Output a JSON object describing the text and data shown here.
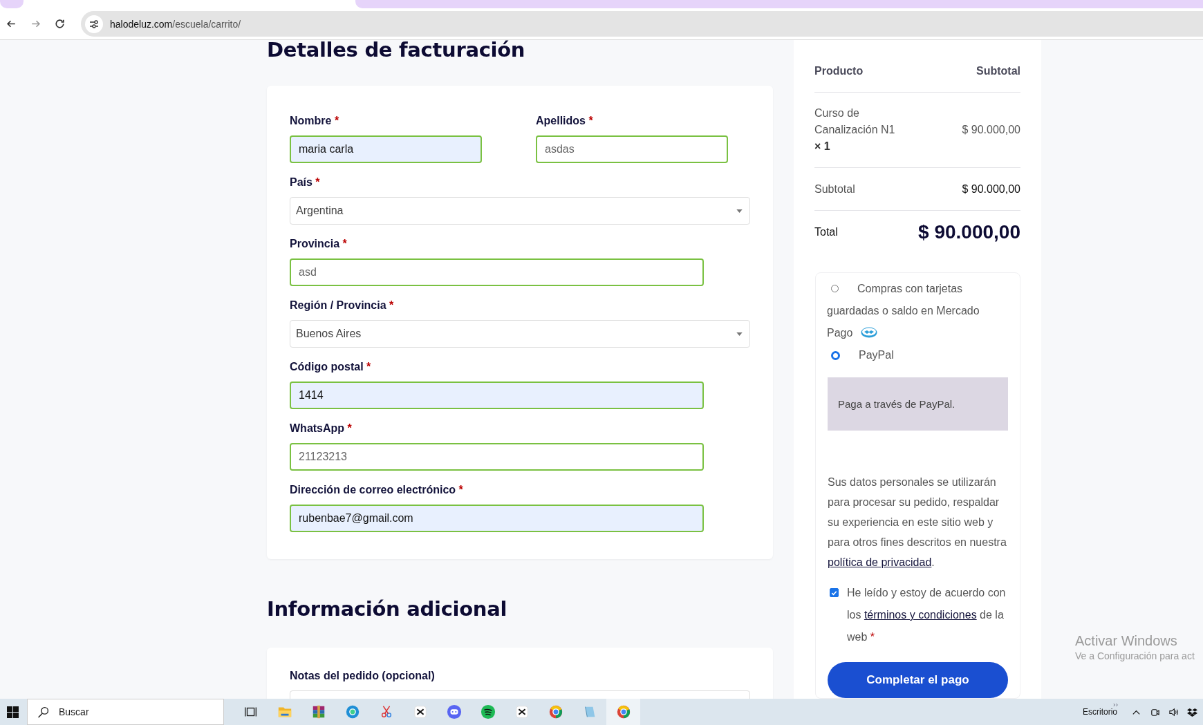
{
  "browser": {
    "url_host": "halodeluz.com",
    "url_path": "/escuela/carrito/"
  },
  "billing": {
    "title": "Detalles de facturación",
    "rows": [
      [
        {
          "label": "Nombre",
          "required": "*",
          "kind": "text",
          "value": "maria carla",
          "autofilled": true,
          "valid": true
        },
        {
          "label": "Apellidos",
          "required": "*",
          "kind": "text",
          "value": "asdas",
          "autofilled": false,
          "valid": true
        }
      ],
      [
        {
          "label": "País",
          "required": "*",
          "kind": "select",
          "value": "Argentina"
        }
      ],
      [
        {
          "label": "Provincia",
          "required": "*",
          "kind": "text",
          "value": "asd",
          "autofilled": false,
          "valid": true
        }
      ],
      [
        {
          "label": "Región / Provincia",
          "required": "*",
          "kind": "select",
          "value": "Buenos Aires"
        }
      ],
      [
        {
          "label": "Código postal",
          "required": "*",
          "kind": "text",
          "value": "1414",
          "autofilled": true,
          "valid": true
        }
      ],
      [
        {
          "label": "WhatsApp",
          "required": "*",
          "kind": "text",
          "value": "21123213",
          "autofilled": false,
          "valid": true
        }
      ],
      [
        {
          "label": "Dirección de correo electrónico",
          "required": "*",
          "kind": "text",
          "value": "rubenbae7@gmail.com",
          "autofilled": true,
          "valid": true
        }
      ]
    ]
  },
  "additional": {
    "title": "Información adicional",
    "notes_label": "Notas del pedido (opcional)"
  },
  "order": {
    "headers": [
      "Producto",
      "Subtotal"
    ],
    "items": [
      {
        "name": "Curso de Canalización N1",
        "quantity": "× 1",
        "price": "$ 90.000,00"
      }
    ],
    "subtotal_label": "Subtotal",
    "subtotal": "$ 90.000,00",
    "total_label": "Total",
    "total": "$ 90.000,00"
  },
  "payment": {
    "methods": [
      {
        "label": "Compras con tarjetas guardadas o saldo en Mercado Pago",
        "selected": false,
        "logo": true
      },
      {
        "label": "PayPal",
        "selected": true,
        "logo": false,
        "description": "Paga a través de PayPal."
      }
    ],
    "privacy_text": "Sus datos personales se utilizarán para procesar su pedido, respaldar su experiencia en este sitio web y para otros fines descritos en nuestra",
    "privacy_link": "política de privacidad",
    "privacy_end": ".",
    "terms": {
      "checked": true,
      "before": "He leído y estoy de acuerdo con los",
      "link": "términos y condiciones",
      "after": "de la web",
      "required": "*"
    },
    "submit": "Completar el pago"
  },
  "activation": {
    "title": "Activar Windows",
    "subtitle": "Ve a Configuración para act"
  },
  "taskbar": {
    "search": "Buscar",
    "desktop": "Escritorio"
  }
}
